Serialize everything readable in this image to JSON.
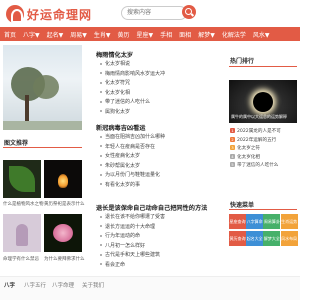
{
  "header": {
    "logo_text": "好运命理网",
    "search_placeholder": "搜索内容"
  },
  "nav": {
    "items": [
      "首页",
      "八字▼",
      "起名▼",
      "周易▼",
      "生肖▼",
      "黄历",
      "星座▼",
      "手相",
      "面相",
      "解梦▼",
      "化解法学",
      "风水▼"
    ]
  },
  "left": {
    "section_title": "图文推荐",
    "thumbs": [
      {
        "caption": "什么是植物风水之物"
      },
      {
        "caption": "黄历祭祀是表示什么"
      },
      {
        "caption": "命理学有什么禁忌"
      },
      {
        "caption": "为什么要拜佛求什么"
      }
    ]
  },
  "middle": {
    "blocks": [
      {
        "title": "梅雨情化太岁",
        "items": [
          "化太岁相说",
          "梅雨情商影响风水岁运大冲",
          "化太岁符咒",
          "化太岁化相",
          "带了迷信的人吃什么",
          "属狗化太岁"
        ]
      },
      {
        "title": "新冠病毒吉凶看运",
        "items": [
          "当面在阻挡吉凶加什么哪种",
          "年轻人在疫病是否存在",
          "女性疫病化太岁",
          "朱砂帮属化太岁",
          "为以月份门与鞋鞋运量化",
          "有看化太岁的事"
        ]
      },
      {
        "title": "退长是该保命自己动命自己把同性的方法",
        "items": [
          "退长在该不给你哪遭了受害",
          "退长方运运的十大命理",
          "行为年运动的命",
          "八月初一怎么样好",
          "古代是手和天上哪些建筑",
          "看会正命"
        ]
      }
    ]
  },
  "right": {
    "hot_title": "热门排行",
    "hot_caption": "属牛的属中以大运总的运势解释",
    "hot_items": [
      {
        "rank": "1",
        "text": "2022属龙的人是不可"
      },
      {
        "rank": "2",
        "text": "2022年运解的五行"
      },
      {
        "rank": "3",
        "text": "化太岁之符"
      },
      {
        "rank": "4",
        "text": "化太岁化相"
      },
      {
        "rank": "5",
        "text": "带了迷信的人吃什么"
      }
    ],
    "quick_title": "快速菜单",
    "quick_buttons": [
      "星座查询",
      "八字算命",
      "周易算卦",
      "生肖运势",
      "黄历查询",
      "起名大全",
      "解梦大全",
      "风水布局"
    ]
  },
  "bottom": {
    "tabs": [
      "八字",
      "八字五行",
      "八字命理",
      "关于我们"
    ]
  },
  "colors": {
    "accent": "#e25b45",
    "quick_palette": [
      "#e25b45",
      "#3d8fd6",
      "#46b06a",
      "#f2a33a"
    ]
  }
}
